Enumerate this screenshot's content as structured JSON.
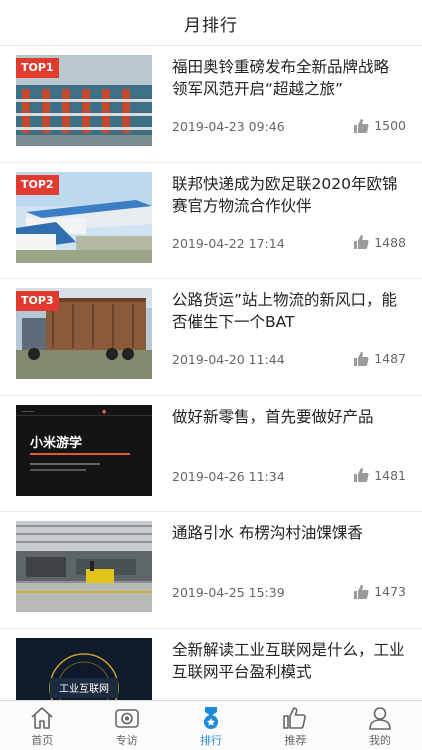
{
  "header": {
    "title": "月排行"
  },
  "articles": [
    {
      "rank": "TOP1",
      "title": "福田奥铃重磅发布全新品牌战略 领军风范开启“超越之旅”",
      "date": "2019-04-23 09:46",
      "likes": "1500",
      "thumb": "warehouse"
    },
    {
      "rank": "TOP2",
      "title": "联邦快递成为欧足联2020年欧锦赛官方物流合作伙伴",
      "date": "2019-04-22 17:14",
      "likes": "1488",
      "thumb": "building"
    },
    {
      "rank": "TOP3",
      "title": "公路货运”站上物流的新风口，能否催生下一个BAT",
      "date": "2019-04-20 11:44",
      "likes": "1487",
      "thumb": "truck"
    },
    {
      "rank": "",
      "title": "做好新零售，首先要做好产品",
      "date": "2019-04-26 11:34",
      "likes": "1481",
      "thumb": "xiaomi",
      "thumb_text": "小米游学"
    },
    {
      "rank": "",
      "title": "通路引水 布楞沟村油馃馃香",
      "date": "2019-04-25 15:39",
      "likes": "1473",
      "thumb": "factory"
    },
    {
      "rank": "",
      "title": "全新解读工业互联网是什么，工业互联网平台盈利模式",
      "date": "",
      "likes": "",
      "thumb": "industrial",
      "thumb_text": "工业互联网"
    }
  ],
  "tabs": [
    {
      "label": "首页",
      "icon": "home-icon",
      "active": false
    },
    {
      "label": "专访",
      "icon": "camera-icon",
      "active": false
    },
    {
      "label": "排行",
      "icon": "ranking-icon",
      "active": true
    },
    {
      "label": "推荐",
      "icon": "thumbs-up-icon",
      "active": false
    },
    {
      "label": "我的",
      "icon": "user-icon",
      "active": false
    }
  ],
  "colors": {
    "accent": "#1f8ad8",
    "rank_badge": "#e23a2e",
    "text_secondary": "#666666"
  }
}
